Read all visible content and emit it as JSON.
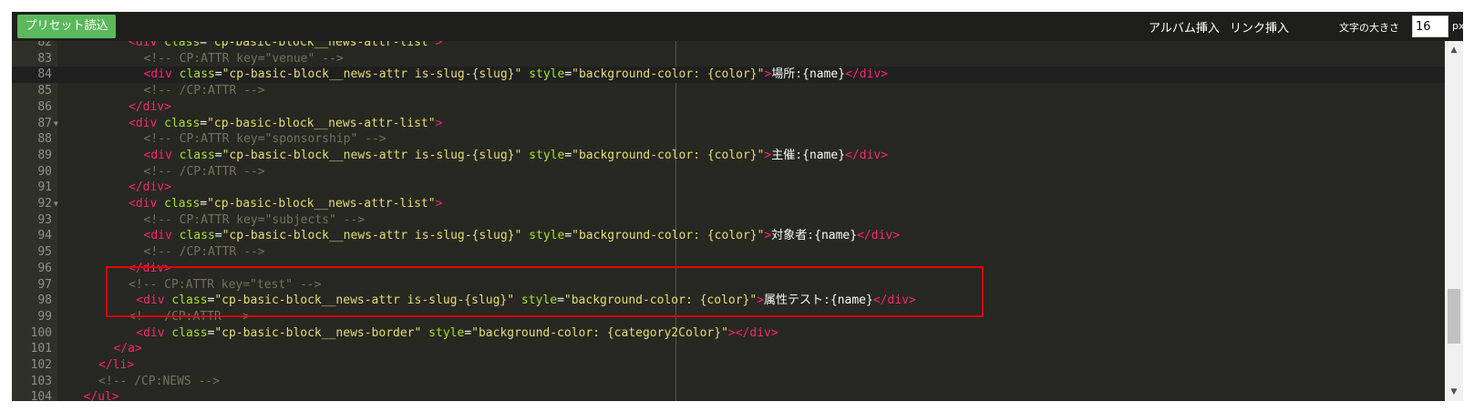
{
  "toolbar": {
    "preset_button": "プリセット読込",
    "album_insert": "アルバム挿入",
    "link_insert": "リンク挿入",
    "font_size_label": "文字の大きさ",
    "font_size_value": "16",
    "font_size_unit": "px"
  },
  "editor": {
    "active_line": "84",
    "lines": [
      {
        "n": "82",
        "fold": false,
        "indent": 4,
        "tokens": [
          [
            "tg",
            "<"
          ],
          [
            "tg",
            "div"
          ],
          [
            "at",
            " class"
          ],
          [
            "tx",
            "="
          ],
          [
            "st",
            "\"cp-basic-block__news-attr-list\""
          ],
          [
            "tg",
            ">"
          ]
        ]
      },
      {
        "n": "83",
        "fold": false,
        "indent": 5,
        "tokens": [
          [
            "cm",
            "<!-- CP:ATTR key=\"venue\" -->"
          ]
        ]
      },
      {
        "n": "84",
        "fold": false,
        "indent": 5,
        "tokens": [
          [
            "tg",
            "<"
          ],
          [
            "tg",
            "div"
          ],
          [
            "at",
            " class"
          ],
          [
            "tx",
            "="
          ],
          [
            "st",
            "\"cp-basic-block__news-attr is-slug-{slug}\""
          ],
          [
            "at",
            " style"
          ],
          [
            "tx",
            "="
          ],
          [
            "st",
            "\"background-color: {color}\""
          ],
          [
            "tg",
            ">"
          ],
          [
            "tx",
            "場所:{name}"
          ],
          [
            "tg",
            "</"
          ],
          [
            "tg",
            "div"
          ],
          [
            "tg",
            ">"
          ]
        ]
      },
      {
        "n": "85",
        "fold": false,
        "indent": 5,
        "tokens": [
          [
            "cm",
            "<!-- /CP:ATTR -->"
          ]
        ]
      },
      {
        "n": "86",
        "fold": false,
        "indent": 4,
        "tokens": [
          [
            "tg",
            "</"
          ],
          [
            "tg",
            "div"
          ],
          [
            "tg",
            ">"
          ]
        ]
      },
      {
        "n": "87",
        "fold": true,
        "indent": 4,
        "tokens": [
          [
            "tg",
            "<"
          ],
          [
            "tg",
            "div"
          ],
          [
            "at",
            " class"
          ],
          [
            "tx",
            "="
          ],
          [
            "st",
            "\"cp-basic-block__news-attr-list\""
          ],
          [
            "tg",
            ">"
          ]
        ]
      },
      {
        "n": "88",
        "fold": false,
        "indent": 5,
        "tokens": [
          [
            "cm",
            "<!-- CP:ATTR key=\"sponsorship\" -->"
          ]
        ]
      },
      {
        "n": "89",
        "fold": false,
        "indent": 5,
        "tokens": [
          [
            "tg",
            "<"
          ],
          [
            "tg",
            "div"
          ],
          [
            "at",
            " class"
          ],
          [
            "tx",
            "="
          ],
          [
            "st",
            "\"cp-basic-block__news-attr is-slug-{slug}\""
          ],
          [
            "at",
            " style"
          ],
          [
            "tx",
            "="
          ],
          [
            "st",
            "\"background-color: {color}\""
          ],
          [
            "tg",
            ">"
          ],
          [
            "tx",
            "主催:{name}"
          ],
          [
            "tg",
            "</"
          ],
          [
            "tg",
            "div"
          ],
          [
            "tg",
            ">"
          ]
        ]
      },
      {
        "n": "90",
        "fold": false,
        "indent": 5,
        "tokens": [
          [
            "cm",
            "<!-- /CP:ATTR -->"
          ]
        ]
      },
      {
        "n": "91",
        "fold": false,
        "indent": 4,
        "tokens": [
          [
            "tg",
            "</"
          ],
          [
            "tg",
            "div"
          ],
          [
            "tg",
            ">"
          ]
        ]
      },
      {
        "n": "92",
        "fold": true,
        "indent": 4,
        "tokens": [
          [
            "tg",
            "<"
          ],
          [
            "tg",
            "div"
          ],
          [
            "at",
            " class"
          ],
          [
            "tx",
            "="
          ],
          [
            "st",
            "\"cp-basic-block__news-attr-list\""
          ],
          [
            "tg",
            ">"
          ]
        ]
      },
      {
        "n": "93",
        "fold": false,
        "indent": 5,
        "tokens": [
          [
            "cm",
            "<!-- CP:ATTR key=\"subjects\" -->"
          ]
        ]
      },
      {
        "n": "94",
        "fold": false,
        "indent": 5,
        "tokens": [
          [
            "tg",
            "<"
          ],
          [
            "tg",
            "div"
          ],
          [
            "at",
            " class"
          ],
          [
            "tx",
            "="
          ],
          [
            "st",
            "\"cp-basic-block__news-attr is-slug-{slug}\""
          ],
          [
            "at",
            " style"
          ],
          [
            "tx",
            "="
          ],
          [
            "st",
            "\"background-color: {color}\""
          ],
          [
            "tg",
            ">"
          ],
          [
            "tx",
            "対象者:{name}"
          ],
          [
            "tg",
            "</"
          ],
          [
            "tg",
            "div"
          ],
          [
            "tg",
            ">"
          ]
        ]
      },
      {
        "n": "95",
        "fold": false,
        "indent": 5,
        "tokens": [
          [
            "cm",
            "<!-- /CP:ATTR -->"
          ]
        ]
      },
      {
        "n": "96",
        "fold": false,
        "indent": 4,
        "tokens": [
          [
            "tg",
            "</"
          ],
          [
            "tg",
            "div"
          ],
          [
            "tg",
            ">"
          ]
        ]
      },
      {
        "n": "97",
        "fold": false,
        "indent": 4,
        "tokens": [
          [
            "cm",
            "<!-- CP:ATTR key=\"test\" -->"
          ]
        ]
      },
      {
        "n": "98",
        "fold": false,
        "indent": 4.5,
        "tokens": [
          [
            "tg",
            "<"
          ],
          [
            "tg",
            "div"
          ],
          [
            "at",
            " class"
          ],
          [
            "tx",
            "="
          ],
          [
            "st",
            "\"cp-basic-block__news-attr is-slug-{slug}\""
          ],
          [
            "at",
            " style"
          ],
          [
            "tx",
            "="
          ],
          [
            "st",
            "\"background-color: {color}\""
          ],
          [
            "tg",
            ">"
          ],
          [
            "tx",
            "属性テスト:{name}"
          ],
          [
            "tg",
            "</"
          ],
          [
            "tg",
            "div"
          ],
          [
            "tg",
            ">"
          ]
        ]
      },
      {
        "n": "99",
        "fold": false,
        "indent": 4,
        "tokens": [
          [
            "cm",
            "<!-- /CP:ATTR -->"
          ]
        ]
      },
      {
        "n": "100",
        "fold": false,
        "indent": 4.5,
        "tokens": [
          [
            "tg",
            "<"
          ],
          [
            "tg",
            "div"
          ],
          [
            "at",
            " class"
          ],
          [
            "tx",
            "="
          ],
          [
            "st",
            "\"cp-basic-block__news-border\""
          ],
          [
            "at",
            " style"
          ],
          [
            "tx",
            "="
          ],
          [
            "st",
            "\"background-color: {category2Color}\""
          ],
          [
            "tg",
            "></"
          ],
          [
            "tg",
            "div"
          ],
          [
            "tg",
            ">"
          ]
        ]
      },
      {
        "n": "101",
        "fold": false,
        "indent": 3,
        "tokens": [
          [
            "tg",
            "</"
          ],
          [
            "tg",
            "a"
          ],
          [
            "tg",
            ">"
          ]
        ]
      },
      {
        "n": "102",
        "fold": false,
        "indent": 2,
        "tokens": [
          [
            "tg",
            "</"
          ],
          [
            "tg",
            "li"
          ],
          [
            "tg",
            ">"
          ]
        ]
      },
      {
        "n": "103",
        "fold": false,
        "indent": 2,
        "tokens": [
          [
            "cm",
            "<!-- /CP:NEWS -->"
          ]
        ]
      },
      {
        "n": "104",
        "fold": false,
        "indent": 1,
        "tokens": [
          [
            "tg",
            "</"
          ],
          [
            "tg",
            "ul"
          ],
          [
            "tg",
            ">"
          ]
        ]
      }
    ]
  }
}
